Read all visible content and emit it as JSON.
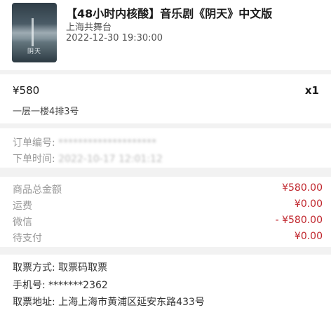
{
  "show": {
    "title": "【48小时内核酸】音乐剧《阴天》中文版",
    "venue": "上海共舞台",
    "datetime": "2022-12-30 19:30:00",
    "poster_text": "阴天"
  },
  "ticket": {
    "price": "¥580",
    "quantity": "x1",
    "seat": "一层一楼4排3号"
  },
  "order": {
    "number_label": "订单编号:",
    "number_value": "********************",
    "time_label": "下单时间:",
    "time_value": "2022-10-17 12:01:12"
  },
  "fees": [
    {
      "label": "商品总金额",
      "value": "¥580.00"
    },
    {
      "label": "运费",
      "value": "¥0.00"
    },
    {
      "label": "微信",
      "value": "- ¥580.00"
    },
    {
      "label": "待支付",
      "value": "¥0.00"
    }
  ],
  "delivery": {
    "method_label": "取票方式:",
    "method_value": "取票码取票",
    "phone_label": "手机号:",
    "phone_value": "*******2362",
    "address_label": "取票地址:",
    "address_value": "上海上海市黄浦区延安东路433号"
  },
  "colors": {
    "accent_red": "#c0262d",
    "divider_gray": "#f2f2f2"
  }
}
